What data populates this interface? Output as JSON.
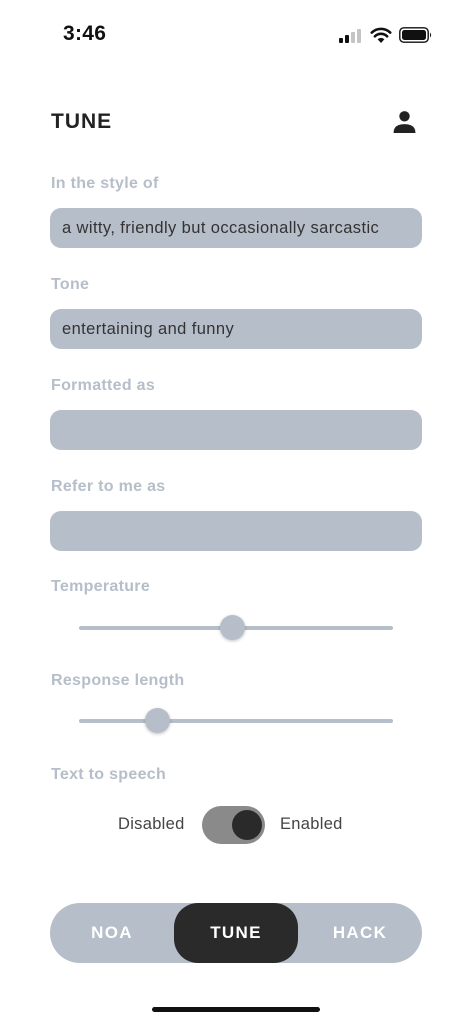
{
  "status_bar": {
    "time": "3:46",
    "icons": [
      "signal-icon",
      "wifi-icon",
      "battery-icon"
    ]
  },
  "header": {
    "title": "TUNE",
    "profile_icon": "person-icon"
  },
  "form": {
    "style": {
      "label": "In the style of",
      "value": "a witty, friendly but occasionally sarcastic"
    },
    "tone": {
      "label": "Tone",
      "value": "entertaining and funny"
    },
    "format": {
      "label": "Formatted as",
      "value": ""
    },
    "refer": {
      "label": "Refer to me as",
      "value": ""
    },
    "temperature": {
      "label": "Temperature",
      "value": 0.49
    },
    "response_length": {
      "label": "Response length",
      "value": 0.25
    },
    "tts": {
      "label": "Text to speech",
      "off_label": "Disabled",
      "on_label": "Enabled",
      "enabled": true
    }
  },
  "tabs": [
    {
      "label": "NOA",
      "active": false
    },
    {
      "label": "TUNE",
      "active": true
    },
    {
      "label": "HACK",
      "active": false
    }
  ],
  "colors": {
    "accent_gray": "#b6bec9",
    "active_tab": "#2a2a2a",
    "toggle_track": "#8a8a8a",
    "text_dark": "#222222"
  }
}
